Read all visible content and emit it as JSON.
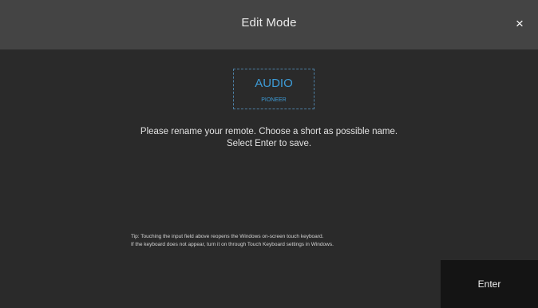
{
  "header": {
    "title": "Edit Mode",
    "close_label": "×"
  },
  "remote_name": {
    "name": "AUDIO",
    "brand": "PIONEER"
  },
  "instruction": {
    "line1": "Please rename your remote. Choose a short as possible name.",
    "line2": "Select Enter to save."
  },
  "tip": {
    "line1": "Tip: Touching the input field above reopens the Windows on-screen touch keyboard.",
    "line2": "If the keyboard does not appear, turn it on through Touch Keyboard settings in Windows."
  },
  "footer": {
    "enter_label": "Enter"
  },
  "colors": {
    "background": "#2a2a2a",
    "header": "#444444",
    "accent": "#3d9bd6",
    "enter_button": "#141414"
  }
}
